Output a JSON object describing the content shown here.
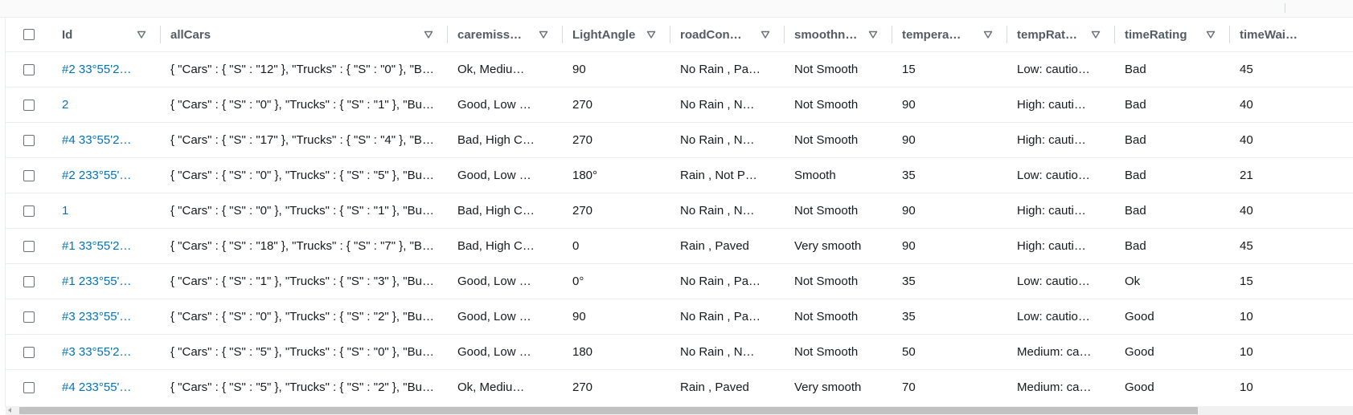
{
  "columns": [
    {
      "key": "id",
      "label": "Id",
      "sort_icon": "sort-down-icon"
    },
    {
      "key": "allcars",
      "label": "allCars",
      "sort_icon": "sort-down-icon"
    },
    {
      "key": "caremiss",
      "label": "caremiss…",
      "sort_icon": "sort-down-icon"
    },
    {
      "key": "lightangle",
      "label": "LightAngle",
      "sort_icon": "sort-down-icon"
    },
    {
      "key": "roadcon",
      "label": "roadCon…",
      "sort_icon": "sort-down-icon"
    },
    {
      "key": "smoothn",
      "label": "smoothn…",
      "sort_icon": "sort-down-icon"
    },
    {
      "key": "tempera",
      "label": "tempera…",
      "sort_icon": "sort-down-icon"
    },
    {
      "key": "temprat",
      "label": "tempRat…",
      "sort_icon": "sort-down-icon"
    },
    {
      "key": "timerating",
      "label": "timeRating",
      "sort_icon": "sort-down-icon"
    },
    {
      "key": "timewai",
      "label": "timeWai…",
      "sort_icon": "sort-down-icon"
    }
  ],
  "rows": [
    [
      "#2 33°55'2…",
      "{ \"Cars\" : { \"S\" : \"12\" }, \"Trucks\" : { \"S\" : \"0\" }, \"B…",
      "Ok, Mediu…",
      "90",
      "No Rain , Pa…",
      "Not Smooth",
      "15",
      "Low: cautio…",
      "Bad",
      "45"
    ],
    [
      "2",
      "{ \"Cars\" : { \"S\" : \"0\" }, \"Trucks\" : { \"S\" : \"1\" }, \"Bus…",
      "Good, Low …",
      "270",
      "No Rain , N…",
      "Not Smooth",
      "90",
      "High: cauti…",
      "Bad",
      "40"
    ],
    [
      "#4 33°55'2…",
      "{ \"Cars\" : { \"S\" : \"17\" }, \"Trucks\" : { \"S\" : \"4\" }, \"B…",
      "Bad, High C…",
      "270",
      "No Rain , N…",
      "Not Smooth",
      "90",
      "High: cauti…",
      "Bad",
      "40"
    ],
    [
      "#2 233°55'…",
      "{ \"Cars\" : { \"S\" : \"0\" }, \"Trucks\" : { \"S\" : \"5\" }, \"Bus…",
      "Good, Low …",
      "180°",
      "Rain , Not P…",
      "Smooth",
      "35",
      "Low: cautio…",
      "Bad",
      "21"
    ],
    [
      "1",
      "{ \"Cars\" : { \"S\" : \"0\" }, \"Trucks\" : { \"S\" : \"1\" }, \"Bus…",
      "Bad, High C…",
      "270",
      "No Rain , N…",
      "Not Smooth",
      "90",
      "High: cauti…",
      "Bad",
      "40"
    ],
    [
      "#1 33°55'2…",
      "{ \"Cars\" : { \"S\" : \"18\" }, \"Trucks\" : { \"S\" : \"7\" }, \"B…",
      "Bad, High C…",
      "0",
      "Rain , Paved",
      "Very smooth",
      "90",
      "High: cauti…",
      "Bad",
      "45"
    ],
    [
      "#1 233°55'…",
      "{ \"Cars\" : { \"S\" : \"1\" }, \"Trucks\" : { \"S\" : \"3\" }, \"Bus…",
      "Good, Low …",
      "0°",
      "No Rain , Pa…",
      "Not Smooth",
      "35",
      "Low: cautio…",
      "Ok",
      "15"
    ],
    [
      "#3 233°55'…",
      "{ \"Cars\" : { \"S\" : \"0\" }, \"Trucks\" : { \"S\" : \"2\" }, \"Bus…",
      "Good, Low …",
      "90",
      "No Rain , Pa…",
      "Not Smooth",
      "35",
      "Low: cautio…",
      "Good",
      "10"
    ],
    [
      "#3 33°55'2…",
      "{ \"Cars\" : { \"S\" : \"5\" }, \"Trucks\" : { \"S\" : \"0\" }, \"Bus…",
      "Good, Low …",
      "180",
      "No Rain , N…",
      "Not Smooth",
      "50",
      "Medium: ca…",
      "Good",
      "10"
    ],
    [
      "#4 233°55'…",
      "{ \"Cars\" : { \"S\" : \"5\" }, \"Trucks\" : { \"S\" : \"2\" }, \"Bus…",
      "Ok, Mediu…",
      "270",
      "Rain , Paved",
      "Very smooth",
      "70",
      "Medium: ca…",
      "Good",
      "10"
    ]
  ],
  "colors": {
    "link": "#0073bb",
    "header_text": "#545b64",
    "cell_text": "#16191f",
    "divider": "#eaeded"
  }
}
